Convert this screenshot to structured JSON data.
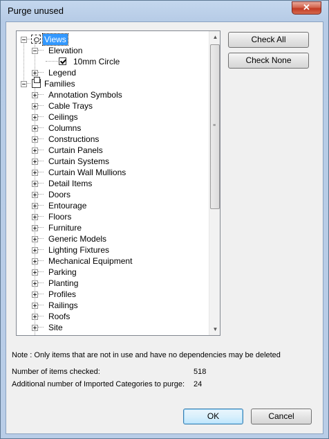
{
  "window": {
    "title": "Purge unused",
    "close_glyph": "✕"
  },
  "tree": {
    "items": [
      {
        "label": "Views",
        "expander": "minus",
        "icon": "views-icon",
        "selected": true
      },
      {
        "label": "Elevation",
        "expander": "minus"
      },
      {
        "label": "10mm Circle",
        "checked": true
      },
      {
        "label": "Legend",
        "expander": "plus"
      },
      {
        "label": "Families",
        "expander": "minus",
        "icon": "families-icon"
      },
      {
        "label": "Annotation Symbols",
        "expander": "plus"
      },
      {
        "label": "Cable Trays",
        "expander": "plus"
      },
      {
        "label": "Ceilings",
        "expander": "plus"
      },
      {
        "label": "Columns",
        "expander": "plus"
      },
      {
        "label": "Constructions",
        "expander": "plus"
      },
      {
        "label": "Curtain Panels",
        "expander": "plus"
      },
      {
        "label": "Curtain Systems",
        "expander": "plus"
      },
      {
        "label": "Curtain Wall Mullions",
        "expander": "plus"
      },
      {
        "label": "Detail Items",
        "expander": "plus"
      },
      {
        "label": "Doors",
        "expander": "plus"
      },
      {
        "label": "Entourage",
        "expander": "plus"
      },
      {
        "label": "Floors",
        "expander": "plus"
      },
      {
        "label": "Furniture",
        "expander": "plus"
      },
      {
        "label": "Generic Models",
        "expander": "plus"
      },
      {
        "label": "Lighting Fixtures",
        "expander": "plus"
      },
      {
        "label": "Mechanical Equipment",
        "expander": "plus"
      },
      {
        "label": "Parking",
        "expander": "plus"
      },
      {
        "label": "Planting",
        "expander": "plus"
      },
      {
        "label": "Profiles",
        "expander": "plus"
      },
      {
        "label": "Railings",
        "expander": "plus"
      },
      {
        "label": "Roofs",
        "expander": "plus"
      },
      {
        "label": "Site",
        "expander": "plus"
      }
    ]
  },
  "buttons": {
    "check_all": "Check All",
    "check_none": "Check None",
    "ok": "OK",
    "cancel": "Cancel"
  },
  "note": "Note : Only items that are not in use and have no dependencies may be deleted",
  "stats": {
    "items_checked_label": "Number of items checked:",
    "items_checked_value": "518",
    "imported_label": "Additional number of Imported Categories to purge:",
    "imported_value": "24"
  },
  "colors": {
    "selection": "#3399ff",
    "title_bar": "#b9cde7",
    "close_button": "#c23a23"
  }
}
